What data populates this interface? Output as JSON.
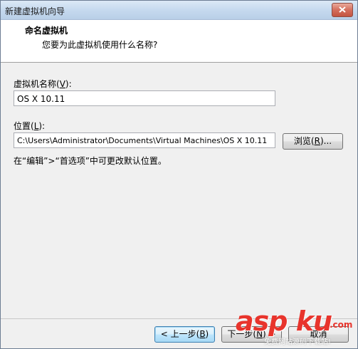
{
  "window": {
    "title": "新建虚拟机向导"
  },
  "header": {
    "title": "命名虚拟机",
    "subtitle": "您要为此虚拟机使用什么名称?"
  },
  "form": {
    "name_label": "虚拟机名称(",
    "name_key": "V",
    "name_label_end": "):",
    "name_value": "OS X 10.11",
    "location_label": "位置(",
    "location_key": "L",
    "location_label_end": "):",
    "location_value": "C:\\Users\\Administrator\\Documents\\Virtual Machines\\OS X 10.11",
    "browse_label": "浏览(",
    "browse_key": "R",
    "browse_label_end": ")...",
    "hint": "在“编辑”>“首选项”中可更改默认位置。"
  },
  "footer": {
    "back_label": "< 上一步(",
    "back_key": "B",
    "back_end": ")",
    "next_label": "下一步(",
    "next_key": "N",
    "next_end": ") >",
    "cancel_label": "取消"
  },
  "watermark": {
    "brand": "asp ku",
    "brand_suffix": ".com",
    "tagline": "免费网站源码下载站!"
  },
  "colors": {
    "accent": "#3c7fb1",
    "watermark_red": "#e8342c"
  }
}
